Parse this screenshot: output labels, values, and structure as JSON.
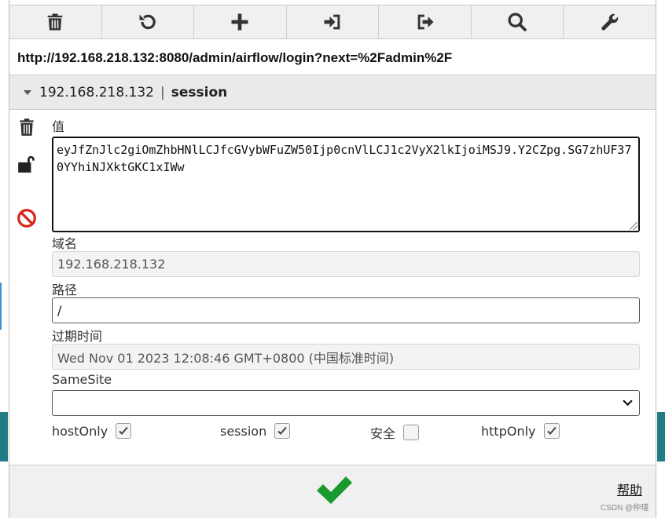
{
  "url": "http://192.168.218.132:8080/admin/airflow/login?next=%2Fadmin%2F",
  "toolbar": {
    "buttons": [
      "trash-icon",
      "undo-icon",
      "plus-icon",
      "import-icon",
      "export-icon",
      "search-icon",
      "wrench-icon"
    ]
  },
  "cookie": {
    "domain_label": "192.168.218.132",
    "separator": "|",
    "name": "session"
  },
  "form": {
    "value_label": "值",
    "value": "eyJfZnJlc2giOmZhbHNlLCJfcGVybWFuZW50Ijp0cnVlLCJ1c2VyX2lkIjoiMSJ9.Y2CZpg.SG7zhUF370YYhiNJXktGKC1xIWw",
    "domain_field_label": "域名",
    "domain_value": "192.168.218.132",
    "path_label": "路径",
    "path_value": "/",
    "expires_label": "过期时间",
    "expires_value": "Wed Nov 01 2023 12:08:46 GMT+0800 (中国标准时间)",
    "samesite_label": "SameSite",
    "samesite_value": ""
  },
  "checks": [
    {
      "label": "hostOnly",
      "checked": true
    },
    {
      "label": "session",
      "checked": true
    },
    {
      "label": "安全",
      "checked": false
    },
    {
      "label": "httpOnly",
      "checked": true
    }
  ],
  "footer": {
    "help": "帮助",
    "watermark": "CSDN @仲瑾"
  },
  "colors": {
    "confirm": "#1a9a2e",
    "block": "#d9261c"
  }
}
